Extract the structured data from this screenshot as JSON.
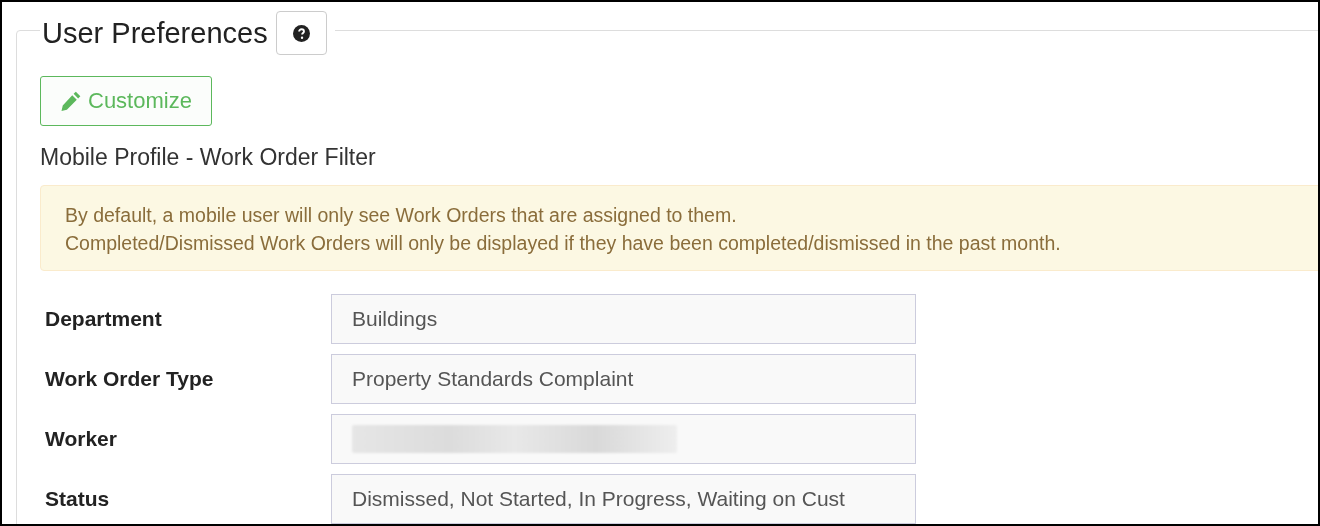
{
  "panel": {
    "title": "User Preferences",
    "help_button": {
      "kind": "help"
    }
  },
  "customize_button": {
    "label": "Customize"
  },
  "section_title": "Mobile Profile - Work Order Filter",
  "alert": {
    "lines": [
      "By default, a mobile user will only see Work Orders that are assigned to them.",
      "Completed/Dismissed Work Orders will only be displayed if they have been completed/dismissed in the past month."
    ]
  },
  "fields": [
    {
      "label": "Department",
      "kind": "text",
      "value": "Buildings"
    },
    {
      "label": "Work Order Type",
      "kind": "text",
      "value": "Property Standards Complaint"
    },
    {
      "label": "Worker",
      "kind": "redacted"
    },
    {
      "label": "Status",
      "kind": "text",
      "value": "Dismissed, Not Started, In Progress, Waiting on Cust"
    }
  ]
}
